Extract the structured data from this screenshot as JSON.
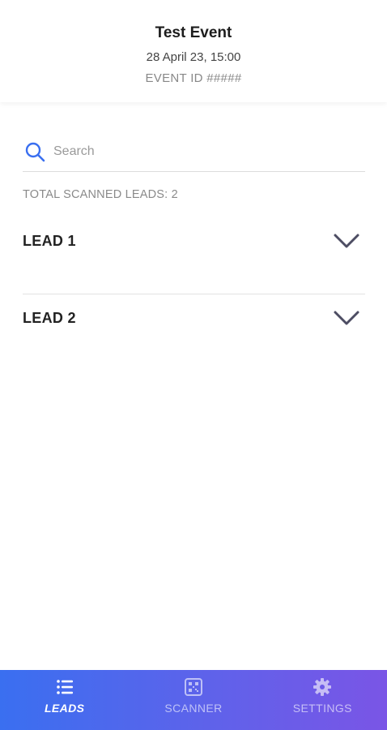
{
  "header": {
    "title": "Test Event",
    "date": "28 April 23, 15:00",
    "event_id": "EVENT ID #####"
  },
  "search": {
    "placeholder": "Search",
    "value": ""
  },
  "total_label": "TOTAL SCANNED LEADS: 2",
  "leads": [
    {
      "label": "LEAD 1",
      "icon": "chevron-down-icon"
    },
    {
      "label": "LEAD 2",
      "icon": "chevron-down-icon"
    }
  ],
  "nav": {
    "items": [
      {
        "label": "LEADS",
        "icon": "list-icon",
        "active": true
      },
      {
        "label": "SCANNER",
        "icon": "qr-code-icon",
        "active": false
      },
      {
        "label": "SETTINGS",
        "icon": "gear-icon",
        "active": false
      }
    ]
  },
  "colors": {
    "accent": "#3a6ff0",
    "nav_gradient_start": "#3a6ff0",
    "nav_gradient_end": "#7a55e6",
    "chevron": "#4d4d63"
  }
}
